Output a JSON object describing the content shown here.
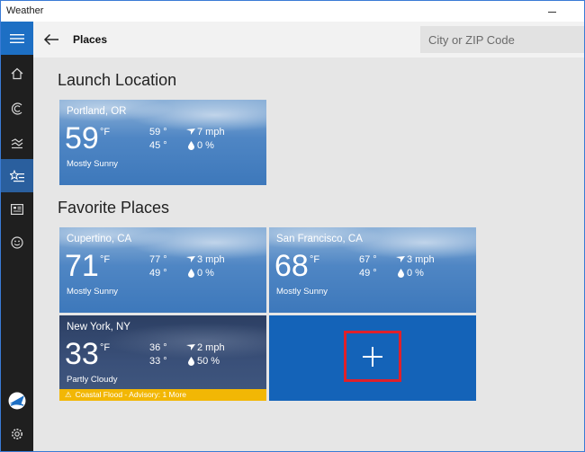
{
  "window": {
    "title": "Weather"
  },
  "header": {
    "page_title": "Places",
    "search_placeholder": "City or ZIP Code"
  },
  "sidebar": {
    "items": [
      {
        "icon": "hamburger-menu-icon"
      },
      {
        "icon": "home-icon"
      },
      {
        "icon": "forecast-icon"
      },
      {
        "icon": "historical-weather-icon"
      },
      {
        "icon": "places-icon",
        "active": true
      },
      {
        "icon": "news-icon"
      },
      {
        "icon": "feedback-icon"
      },
      {
        "icon": "account-icon"
      },
      {
        "icon": "settings-icon"
      }
    ]
  },
  "launch_location": {
    "section_title": "Launch Location",
    "tile": {
      "city": "Portland, OR",
      "temp": "59",
      "unit": "°F",
      "high": "59 °",
      "low": "45 °",
      "wind": "7 mph",
      "precip": "0 %",
      "condition": "Mostly Sunny"
    }
  },
  "favorites": {
    "section_title": "Favorite Places",
    "tiles": [
      {
        "city": "Cupertino, CA",
        "temp": "71",
        "unit": "°F",
        "high": "77 °",
        "low": "49 °",
        "wind": "3 mph",
        "precip": "0 %",
        "condition": "Mostly Sunny"
      },
      {
        "city": "San Francisco, CA",
        "temp": "68",
        "unit": "°F",
        "high": "67 °",
        "low": "49 °",
        "wind": "3 mph",
        "precip": "0 %",
        "condition": "Mostly Sunny"
      },
      {
        "city": "New York, NY",
        "temp": "33",
        "unit": "°F",
        "high": "36 °",
        "low": "33 °",
        "wind": "2 mph",
        "precip": "50 %",
        "condition": "Partly Cloudy",
        "alert": "Coastal Flood - Advisory: 1 More"
      }
    ],
    "add_tile": {
      "icon": "plus-icon"
    }
  },
  "colors": {
    "accent": "#1463b8",
    "alert": "#f2b705",
    "highlight_box": "#e0202a"
  }
}
